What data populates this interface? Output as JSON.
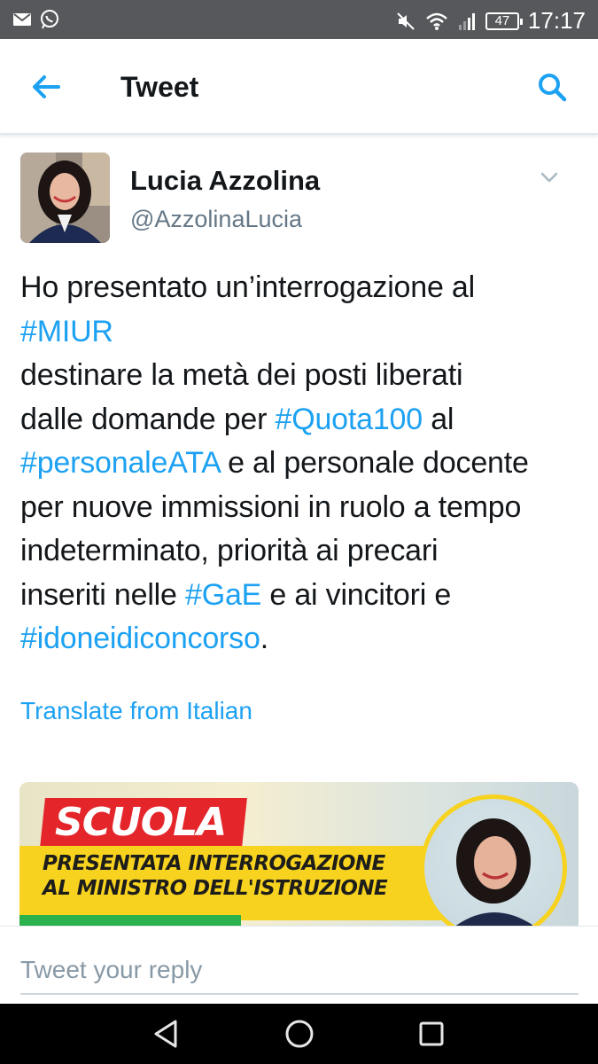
{
  "status_bar": {
    "time": "17:17",
    "battery": "47",
    "icons": [
      "gmail-icon",
      "whatsapp-icon",
      "mute-icon",
      "wifi-icon",
      "signal-icon",
      "battery-icon"
    ]
  },
  "app_bar": {
    "title": "Tweet",
    "back_icon": "arrow-left-icon",
    "search_icon": "search-icon"
  },
  "tweet": {
    "author": {
      "name": "Lucia Azzolina",
      "handle": "@AzzolinaLucia"
    },
    "lines": [
      [
        {
          "text": "Ho presentato un’interrogazione al",
          "tag": false
        }
      ],
      [
        {
          "text": "#MIUR",
          "tag": true
        }
      ],
      [
        {
          "text": "destinare la metà dei posti liberati",
          "tag": false
        }
      ],
      [
        {
          "text": "dalle domande per ",
          "tag": false
        },
        {
          "text": "#Quota100",
          "tag": true
        },
        {
          "text": " al",
          "tag": false
        }
      ],
      [
        {
          "text": "#personaleATA",
          "tag": true
        },
        {
          "text": " e al personale docente",
          "tag": false
        }
      ],
      [
        {
          "text": "per nuove immissioni in ruolo a tempo",
          "tag": false
        }
      ],
      [
        {
          "text": "indeterminato, priorità ai precari",
          "tag": false
        }
      ],
      [
        {
          "text": "inseriti nelle ",
          "tag": false
        },
        {
          "text": "#GaE",
          "tag": true
        },
        {
          "text": " e ai vincitori e",
          "tag": false
        }
      ],
      [
        {
          "text": "#idoneidiconcorso",
          "tag": true
        },
        {
          "text": ".",
          "tag": false
        }
      ]
    ],
    "translate_label": "Translate from Italian",
    "media": {
      "badge": "SCUOLA",
      "headline_1": "PRESENTATA INTERROGAZIONE",
      "headline_2": "AL MINISTRO DELL'ISTRUZIONE"
    }
  },
  "reply": {
    "placeholder": "Tweet your reply"
  },
  "colors": {
    "accent": "#1da1f2",
    "text": "#14171a",
    "muted": "#657786",
    "status_bar": "#56585b",
    "media_red": "#e4262b",
    "media_yellow": "#f7d21e"
  }
}
